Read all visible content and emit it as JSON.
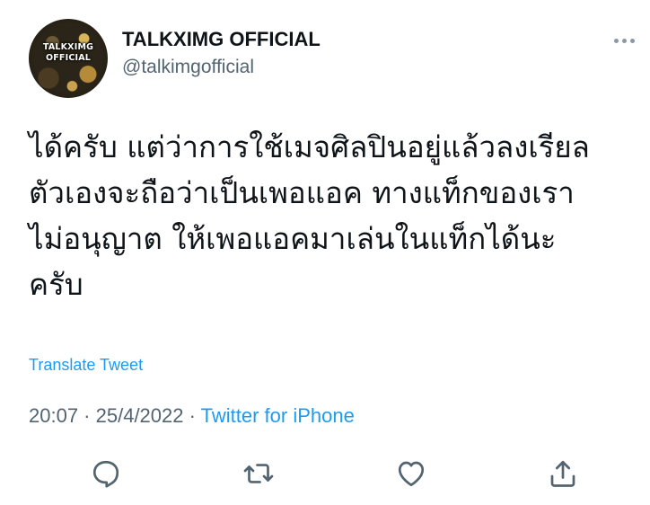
{
  "author": {
    "display_name": "TALKXIMG OFFICIAL",
    "handle": "@talkimgofficial",
    "avatar_text_line1": "TALKXIMG",
    "avatar_text_line2": "OFFICIAL"
  },
  "tweet": {
    "lines": [
      "ได้ครับ แต่ว่าการใช้เมจศิลปินอยู่แล้วลงเรียล",
      "ตัวเองจะถือว่าเป็นเพอแอค ทางแท็กของเรา",
      "ไม่อนุญาต ให้เพอแอคมาเล่นในแท็กได้นะ",
      "ครับ"
    ],
    "translate_label": "Translate Tweet",
    "time": "20:07",
    "date": "25/4/2022",
    "separator": " · ",
    "source": "Twitter for iPhone"
  },
  "actions": [
    {
      "icon": "reply-icon"
    },
    {
      "icon": "retweet-icon"
    },
    {
      "icon": "like-icon"
    },
    {
      "icon": "share-icon"
    }
  ],
  "colors": {
    "link": "#1d9bf0",
    "secondary_text": "#536471",
    "primary_text": "#0f1419",
    "icon": "#536471"
  }
}
